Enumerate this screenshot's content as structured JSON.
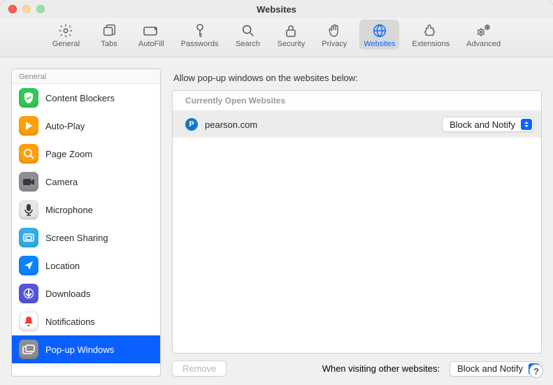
{
  "window": {
    "title": "Websites"
  },
  "toolbar": {
    "items": [
      {
        "id": "general",
        "label": "General"
      },
      {
        "id": "tabs",
        "label": "Tabs"
      },
      {
        "id": "autofill",
        "label": "AutoFill"
      },
      {
        "id": "passwords",
        "label": "Passwords"
      },
      {
        "id": "search",
        "label": "Search"
      },
      {
        "id": "security",
        "label": "Security"
      },
      {
        "id": "privacy",
        "label": "Privacy"
      },
      {
        "id": "websites",
        "label": "Websites",
        "active": true
      },
      {
        "id": "extensions",
        "label": "Extensions"
      },
      {
        "id": "advanced",
        "label": "Advanced"
      }
    ]
  },
  "sidebar": {
    "header": "General",
    "items": [
      {
        "label": "Content Blockers",
        "icon": "shield-check",
        "bg": "#34c759"
      },
      {
        "label": "Auto-Play",
        "icon": "play",
        "bg": "#ff9f0a"
      },
      {
        "label": "Page Zoom",
        "icon": "zoom",
        "bg": "#ff9f0a"
      },
      {
        "label": "Camera",
        "icon": "camera",
        "bg": "#8e8e93"
      },
      {
        "label": "Microphone",
        "icon": "mic",
        "bg": "#e5e5ea"
      },
      {
        "label": "Screen Sharing",
        "icon": "screen",
        "bg": "#32ade6"
      },
      {
        "label": "Location",
        "icon": "location",
        "bg": "#0a84ff"
      },
      {
        "label": "Downloads",
        "icon": "download",
        "bg": "#5856d6"
      },
      {
        "label": "Notifications",
        "icon": "bell",
        "bg": "#ffffff"
      },
      {
        "label": "Pop-up Windows",
        "icon": "popup",
        "bg": "#8e8e93",
        "selected": true
      }
    ]
  },
  "main": {
    "heading": "Allow pop-up windows on the websites below:",
    "list_header": "Currently Open Websites",
    "rows": [
      {
        "site": "pearson.com",
        "favicon_letter": "P",
        "selection": "Block and Notify"
      }
    ],
    "remove_label": "Remove",
    "other_label": "When visiting other websites:",
    "other_value": "Block and Notify"
  },
  "help_label": "?"
}
